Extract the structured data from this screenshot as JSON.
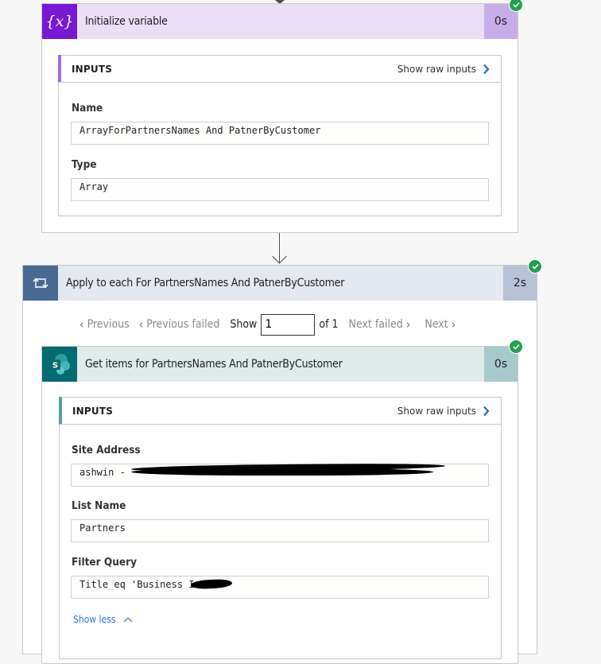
{
  "colors": {
    "variable_accent": "#7719d4",
    "variable_header_bg": "#ebdff8",
    "variable_duration_bg": "#c7aeeb",
    "loop_accent": "#486991",
    "loop_header_bg": "#e4e8f0",
    "loop_duration_bg": "#b7c3d4",
    "sharepoint_accent": "#036c70",
    "sharepoint_header_bg": "#e0ebeb",
    "sharepoint_duration_bg": "#a7c9cb",
    "success": "#23a04c",
    "link": "#2f6fdb"
  },
  "init_variable": {
    "icon": "variable-icon",
    "icon_glyph": "{x}",
    "title": "Initialize variable",
    "duration": "0s",
    "status": "succeeded",
    "inputs": {
      "title": "INPUTS",
      "raw_link": "Show raw inputs",
      "fields": [
        {
          "label": "Name",
          "value": "ArrayForPartnersNames And PatnerByCustomer"
        },
        {
          "label": "Type",
          "value": "Array"
        }
      ]
    }
  },
  "apply_to_each": {
    "icon": "loop-icon",
    "title": "Apply to each For PartnersNames And PatnerByCustomer",
    "duration": "2s",
    "status": "succeeded",
    "pager": {
      "previous": "Previous",
      "previous_failed": "Previous failed",
      "show": "Show",
      "current": "1",
      "of_total": "of 1",
      "next_failed": "Next failed",
      "next": "Next"
    }
  },
  "get_items": {
    "icon": "sharepoint-icon",
    "title": "Get items for PartnersNames And PatnerByCustomer",
    "duration": "0s",
    "status": "succeeded",
    "inputs": {
      "title": "INPUTS",
      "raw_link": "Show raw inputs",
      "fields": [
        {
          "label": "Site Address",
          "value": "ashwin - ",
          "redacted": true
        },
        {
          "label": "List Name",
          "value": "Partners"
        },
        {
          "label": "Filter Query",
          "value": "Title eq 'Business I",
          "redacted": true
        }
      ]
    },
    "show_less": "Show less"
  }
}
